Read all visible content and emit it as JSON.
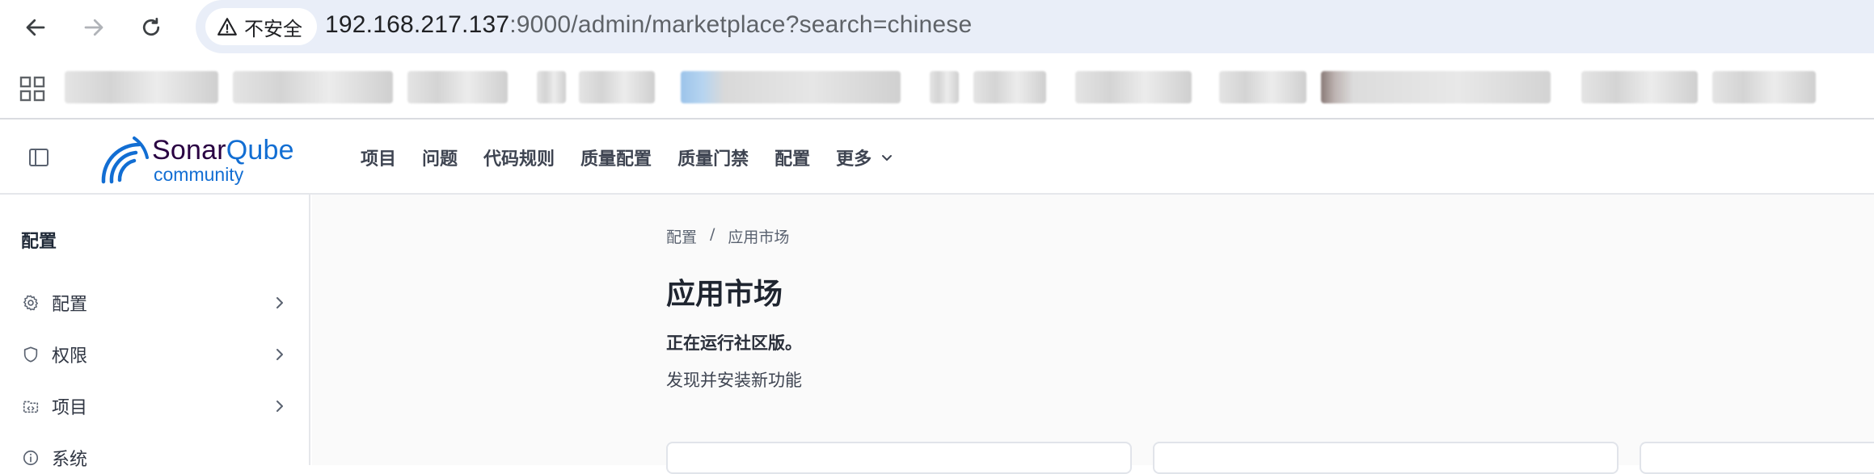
{
  "browser": {
    "security_label": "不安全",
    "url_host": "192.168.217.137",
    "url_rest": ":9000/admin/marketplace?search=chinese"
  },
  "header": {
    "logo_sonar": "Sonar",
    "logo_qube": "Qube",
    "logo_edition": "community",
    "nav": [
      "项目",
      "问题",
      "代码规则",
      "质量配置",
      "质量门禁",
      "配置",
      "更多"
    ]
  },
  "sidebar": {
    "title": "配置",
    "items": [
      {
        "label": "配置",
        "icon": "gear-icon"
      },
      {
        "label": "权限",
        "icon": "shield-icon"
      },
      {
        "label": "项目",
        "icon": "project-folder-icon"
      },
      {
        "label": "系统",
        "icon": "info-icon"
      }
    ]
  },
  "main": {
    "breadcrumb": [
      "配置",
      "应用市场"
    ],
    "breadcrumb_sep": "/",
    "title": "应用市场",
    "edition_note": "正在运行社区版。",
    "subtitle": "发现并安装新功能"
  },
  "colors": {
    "brand_dark": "#290042",
    "brand_blue": "#126ed3",
    "omnibox_bg": "#e9eef8"
  }
}
